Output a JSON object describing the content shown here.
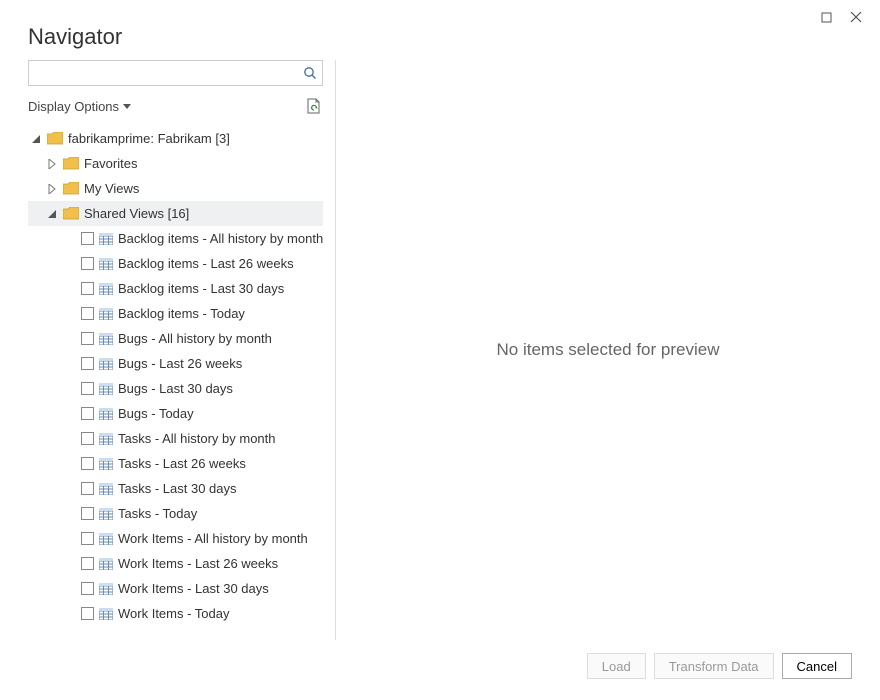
{
  "title": "Navigator",
  "search": {
    "placeholder": ""
  },
  "display_options_label": "Display Options",
  "tree": {
    "root": {
      "label": "fabrikamprime: Fabrikam [3]"
    },
    "favorites": {
      "label": "Favorites"
    },
    "my_views": {
      "label": "My Views"
    },
    "shared_views": {
      "label": "Shared Views [16]"
    },
    "items": [
      {
        "label": "Backlog items - All history by month"
      },
      {
        "label": "Backlog items - Last 26 weeks"
      },
      {
        "label": "Backlog items - Last 30 days"
      },
      {
        "label": "Backlog items - Today"
      },
      {
        "label": "Bugs - All history by month"
      },
      {
        "label": "Bugs - Last 26 weeks"
      },
      {
        "label": "Bugs - Last 30 days"
      },
      {
        "label": "Bugs - Today"
      },
      {
        "label": "Tasks - All history by month"
      },
      {
        "label": "Tasks - Last 26 weeks"
      },
      {
        "label": "Tasks - Last 30 days"
      },
      {
        "label": "Tasks - Today"
      },
      {
        "label": "Work Items - All history by month"
      },
      {
        "label": "Work Items - Last 26 weeks"
      },
      {
        "label": "Work Items - Last 30 days"
      },
      {
        "label": "Work Items - Today"
      }
    ]
  },
  "preview_empty": "No items selected for preview",
  "footer": {
    "load": "Load",
    "transform": "Transform Data",
    "cancel": "Cancel"
  }
}
